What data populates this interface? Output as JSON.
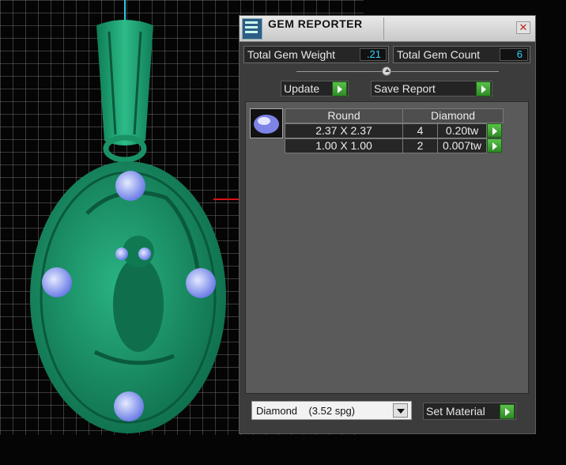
{
  "window": {
    "title": "GEM REPORTER",
    "close_glyph": "✕"
  },
  "totals": {
    "weight_label": "Total Gem Weight",
    "weight_value": ".21",
    "count_label": "Total Gem Count",
    "count_value": "6"
  },
  "buttons": {
    "update_label": "Update",
    "save_label": "Save Report",
    "set_material_label": "Set Material"
  },
  "table": {
    "headers": [
      "Round",
      "Diamond"
    ],
    "rows": [
      {
        "size": "2.37 X 2.37",
        "count": "4",
        "weight": "0.20tw"
      },
      {
        "size": "1.00 X 1.00",
        "count": "2",
        "weight": "0.007tw"
      }
    ]
  },
  "material": {
    "selected": "Diamond    (3.52 spg)"
  },
  "colors": {
    "accent_green": "#3ea832",
    "value_cyan": "#2ed2ff",
    "model_green": "#1f9a6a"
  },
  "icons": [
    "gem-reporter-app-icon",
    "close-icon",
    "play-arrow-icon",
    "dropdown-arrow-icon",
    "gem-thumbnail-icon"
  ]
}
